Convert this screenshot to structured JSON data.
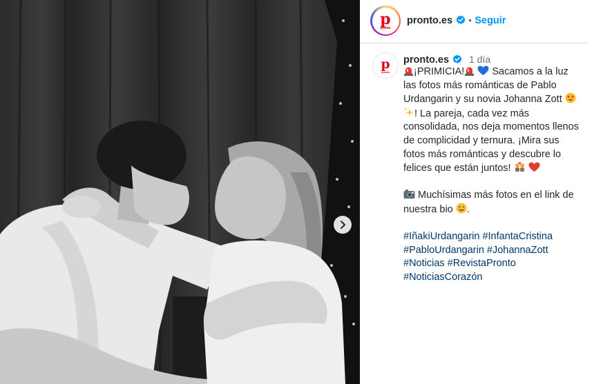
{
  "post": {
    "account": {
      "username": "pronto.es",
      "verified": true,
      "logo_text": "p",
      "logo_subtext": "pronto"
    },
    "follow_label": "Seguir",
    "separator": "•",
    "timestamp": "1 día",
    "caption": {
      "line1_a": "¡PRIMICIA!",
      "line1_b": "Sacamos a la luz",
      "line2": "las fotos más románticas de Pablo",
      "line3": "Urdangarin y su novia Johanna Zott",
      "line4": "! La pareja, cada vez más",
      "line5": "consolidada, nos deja momentos llenos",
      "line6": "de complicidad y ternura. ¡Mira sus",
      "line7": "fotos más románticas y descubre lo",
      "line8": "felices que están juntos!",
      "line9": "Muchísimas más fotos en el link de",
      "line10": "nuestra bio",
      "line10_end": "."
    },
    "hashtags": [
      "#IñakiUrdangarin",
      "#InfantaCristina",
      "#PabloUrdangarin",
      "#JohannaZott",
      "#Noticias",
      "#RevistaPronto",
      "#NoticiasCorazón"
    ],
    "icons": {
      "verified": "verified-badge-icon",
      "next": "chevron-right-icon",
      "siren": "police-light-emoji",
      "heart_blue": "blue-heart-emoji",
      "star_eyes": "star-struck-emoji",
      "sparkles": "sparkles-emoji",
      "couple": "couple-with-heart-emoji",
      "heart_red": "red-heart-emoji",
      "camera": "camera-with-flash-emoji",
      "smile": "smiling-face-emoji"
    },
    "colors": {
      "brand": "#e2001a",
      "link": "#0095f6",
      "hashtag": "#00376b",
      "verified": "#0095f6"
    },
    "carousel": {
      "current_slide": 1,
      "has_next": true
    }
  }
}
